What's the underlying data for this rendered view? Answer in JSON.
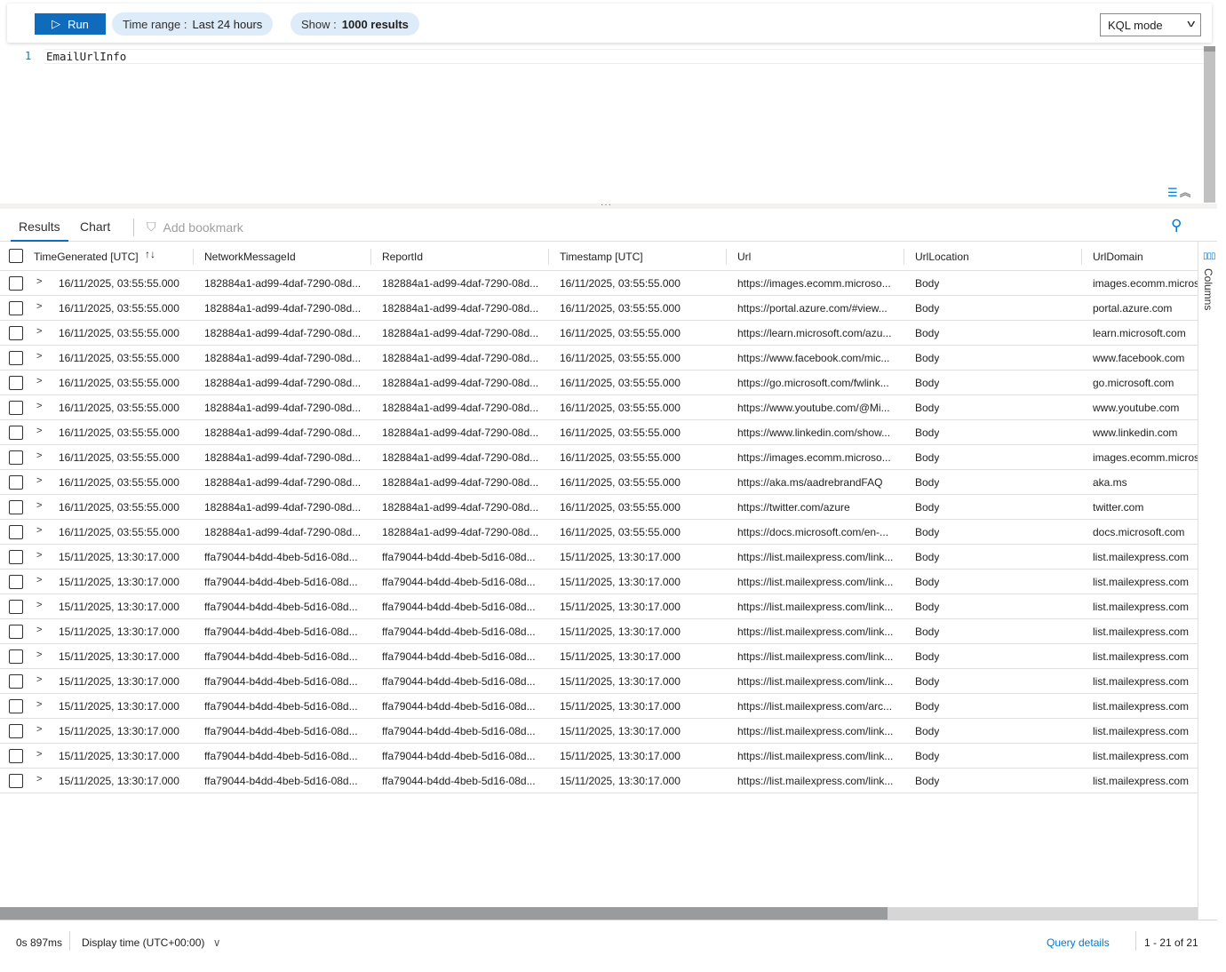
{
  "toolbar": {
    "run_label": "Run",
    "time_range_label": "Time range :",
    "time_range_value": "Last 24 hours",
    "show_label": "Show :",
    "show_value": "1000 results",
    "mode": "KQL mode"
  },
  "editor": {
    "line_number": "1",
    "query": "EmailUrlInfo"
  },
  "results_tabs": {
    "results": "Results",
    "chart": "Chart",
    "add_bookmark": "Add bookmark"
  },
  "columns_panel_label": "Columns",
  "table": {
    "headers": [
      "TimeGenerated [UTC]",
      "NetworkMessageId",
      "ReportId",
      "Timestamp [UTC]",
      "Url",
      "UrlLocation",
      "UrlDomain"
    ],
    "rows": [
      [
        "16/11/2025, 03:55:55.000",
        "182884a1-ad99-4daf-7290-08d...",
        "182884a1-ad99-4daf-7290-08d...",
        "16/11/2025, 03:55:55.000",
        "https://images.ecomm.microso...",
        "Body",
        "images.ecomm.micros"
      ],
      [
        "16/11/2025, 03:55:55.000",
        "182884a1-ad99-4daf-7290-08d...",
        "182884a1-ad99-4daf-7290-08d...",
        "16/11/2025, 03:55:55.000",
        "https://portal.azure.com/#view...",
        "Body",
        "portal.azure.com"
      ],
      [
        "16/11/2025, 03:55:55.000",
        "182884a1-ad99-4daf-7290-08d...",
        "182884a1-ad99-4daf-7290-08d...",
        "16/11/2025, 03:55:55.000",
        "https://learn.microsoft.com/azu...",
        "Body",
        "learn.microsoft.com"
      ],
      [
        "16/11/2025, 03:55:55.000",
        "182884a1-ad99-4daf-7290-08d...",
        "182884a1-ad99-4daf-7290-08d...",
        "16/11/2025, 03:55:55.000",
        "https://www.facebook.com/mic...",
        "Body",
        "www.facebook.com"
      ],
      [
        "16/11/2025, 03:55:55.000",
        "182884a1-ad99-4daf-7290-08d...",
        "182884a1-ad99-4daf-7290-08d...",
        "16/11/2025, 03:55:55.000",
        "https://go.microsoft.com/fwlink...",
        "Body",
        "go.microsoft.com"
      ],
      [
        "16/11/2025, 03:55:55.000",
        "182884a1-ad99-4daf-7290-08d...",
        "182884a1-ad99-4daf-7290-08d...",
        "16/11/2025, 03:55:55.000",
        "https://www.youtube.com/@Mi...",
        "Body",
        "www.youtube.com"
      ],
      [
        "16/11/2025, 03:55:55.000",
        "182884a1-ad99-4daf-7290-08d...",
        "182884a1-ad99-4daf-7290-08d...",
        "16/11/2025, 03:55:55.000",
        "https://www.linkedin.com/show...",
        "Body",
        "www.linkedin.com"
      ],
      [
        "16/11/2025, 03:55:55.000",
        "182884a1-ad99-4daf-7290-08d...",
        "182884a1-ad99-4daf-7290-08d...",
        "16/11/2025, 03:55:55.000",
        "https://images.ecomm.microso...",
        "Body",
        "images.ecomm.micros"
      ],
      [
        "16/11/2025, 03:55:55.000",
        "182884a1-ad99-4daf-7290-08d...",
        "182884a1-ad99-4daf-7290-08d...",
        "16/11/2025, 03:55:55.000",
        "https://aka.ms/aadrebrandFAQ",
        "Body",
        "aka.ms"
      ],
      [
        "16/11/2025, 03:55:55.000",
        "182884a1-ad99-4daf-7290-08d...",
        "182884a1-ad99-4daf-7290-08d...",
        "16/11/2025, 03:55:55.000",
        "https://twitter.com/azure",
        "Body",
        "twitter.com"
      ],
      [
        "16/11/2025, 03:55:55.000",
        "182884a1-ad99-4daf-7290-08d...",
        "182884a1-ad99-4daf-7290-08d...",
        "16/11/2025, 03:55:55.000",
        "https://docs.microsoft.com/en-...",
        "Body",
        "docs.microsoft.com"
      ],
      [
        "15/11/2025, 13:30:17.000",
        "ffa79044-b4dd-4beb-5d16-08d...",
        "ffa79044-b4dd-4beb-5d16-08d...",
        "15/11/2025, 13:30:17.000",
        "https://list.mailexpress.com/link...",
        "Body",
        "list.mailexpress.com"
      ],
      [
        "15/11/2025, 13:30:17.000",
        "ffa79044-b4dd-4beb-5d16-08d...",
        "ffa79044-b4dd-4beb-5d16-08d...",
        "15/11/2025, 13:30:17.000",
        "https://list.mailexpress.com/link...",
        "Body",
        "list.mailexpress.com"
      ],
      [
        "15/11/2025, 13:30:17.000",
        "ffa79044-b4dd-4beb-5d16-08d...",
        "ffa79044-b4dd-4beb-5d16-08d...",
        "15/11/2025, 13:30:17.000",
        "https://list.mailexpress.com/link...",
        "Body",
        "list.mailexpress.com"
      ],
      [
        "15/11/2025, 13:30:17.000",
        "ffa79044-b4dd-4beb-5d16-08d...",
        "ffa79044-b4dd-4beb-5d16-08d...",
        "15/11/2025, 13:30:17.000",
        "https://list.mailexpress.com/link...",
        "Body",
        "list.mailexpress.com"
      ],
      [
        "15/11/2025, 13:30:17.000",
        "ffa79044-b4dd-4beb-5d16-08d...",
        "ffa79044-b4dd-4beb-5d16-08d...",
        "15/11/2025, 13:30:17.000",
        "https://list.mailexpress.com/link...",
        "Body",
        "list.mailexpress.com"
      ],
      [
        "15/11/2025, 13:30:17.000",
        "ffa79044-b4dd-4beb-5d16-08d...",
        "ffa79044-b4dd-4beb-5d16-08d...",
        "15/11/2025, 13:30:17.000",
        "https://list.mailexpress.com/link...",
        "Body",
        "list.mailexpress.com"
      ],
      [
        "15/11/2025, 13:30:17.000",
        "ffa79044-b4dd-4beb-5d16-08d...",
        "ffa79044-b4dd-4beb-5d16-08d...",
        "15/11/2025, 13:30:17.000",
        "https://list.mailexpress.com/arc...",
        "Body",
        "list.mailexpress.com"
      ],
      [
        "15/11/2025, 13:30:17.000",
        "ffa79044-b4dd-4beb-5d16-08d...",
        "ffa79044-b4dd-4beb-5d16-08d...",
        "15/11/2025, 13:30:17.000",
        "https://list.mailexpress.com/link...",
        "Body",
        "list.mailexpress.com"
      ],
      [
        "15/11/2025, 13:30:17.000",
        "ffa79044-b4dd-4beb-5d16-08d...",
        "ffa79044-b4dd-4beb-5d16-08d...",
        "15/11/2025, 13:30:17.000",
        "https://list.mailexpress.com/link...",
        "Body",
        "list.mailexpress.com"
      ],
      [
        "15/11/2025, 13:30:17.000",
        "ffa79044-b4dd-4beb-5d16-08d...",
        "ffa79044-b4dd-4beb-5d16-08d...",
        "15/11/2025, 13:30:17.000",
        "https://list.mailexpress.com/link...",
        "Body",
        "list.mailexpress.com"
      ]
    ]
  },
  "footer": {
    "duration": "0s 897ms",
    "display_time": "Display time (UTC+00:00)",
    "query_details": "Query details",
    "pagination": "1 - 21 of 21"
  },
  "colors": {
    "accent": "#0f6cbd",
    "pill_bg": "#deecf9",
    "link": "#0078d4"
  }
}
